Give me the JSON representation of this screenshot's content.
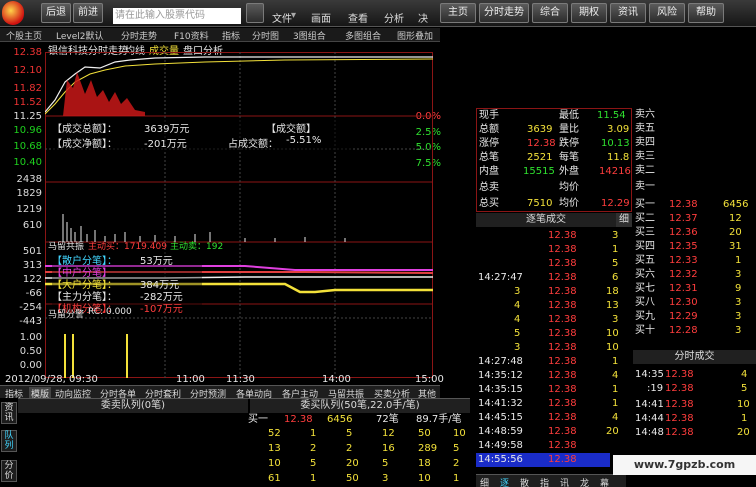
{
  "toolbar": {
    "buttons": [
      "后退",
      "前进",
      "主页",
      "分时走势",
      "综合",
      "期权",
      "资讯",
      "风险",
      "帮助"
    ],
    "back_label": "后退",
    "search_placeholder": "请在此输入股票代码",
    "menu": [
      "文件",
      "画面",
      "查看",
      "分析",
      "决"
    ]
  },
  "sectabs": {
    "items": [
      "个股主页",
      "Level2默认",
      "分时走势",
      "F10资料",
      "指标",
      "分时图",
      "3图组合",
      "多图组合",
      "图形叠加"
    ]
  },
  "chart_header": {
    "title": "银信科技分时走势",
    "legend": [
      "均线",
      "成交量",
      "盘口分析"
    ]
  },
  "price_axis": {
    "left": [
      "12.38",
      "12.10",
      "11.82",
      "11.52",
      "11.25",
      "10.96",
      "10.68",
      "10.40"
    ],
    "vol": [
      "2438",
      "1829",
      "1219",
      "610"
    ],
    "pct": [
      "0.0%",
      "2.5%",
      "5.0%",
      "7.5%"
    ],
    "lower": [
      "501",
      "313",
      "122",
      "-66",
      "-254",
      "-443"
    ]
  },
  "overlay1": {
    "total_turnover": "【成交总额】：",
    "total_value": "3639万元",
    "net_turnover": "【成交净额】：",
    "net_value": "-201万元",
    "ratio_label": "占成交额：",
    "ratio_value": "-5.51%",
    "turnover_tag": "【成交额】"
  },
  "mid_panel": {
    "title": "马留共振",
    "main_buy": "主动买：1719.409",
    "main_sell": "主动卖：192"
  },
  "overlay2": {
    "retail": "【散户分笔】：",
    "retail_val": "53万元",
    "mid": "【中户分笔】",
    "big": "【大户分笔】：",
    "big_val": "384万元",
    "main": "【主力分笔】：",
    "main_val": "-282万元",
    "inst": "【机构分笔】：",
    "inst_val": "-107万元"
  },
  "low_panel": {
    "title": "马留分警",
    "rc": "RC: 0.000",
    "yvals": [
      "1.00",
      "0.50",
      "0.00"
    ]
  },
  "time_axis": {
    "date": "2012/09/28, 09:30",
    "ticks": [
      "11:00",
      "11:30",
      "14:00",
      "15:00"
    ]
  },
  "bottom_tabs": [
    "指标",
    "模版",
    "动向监控",
    "分时各单",
    "分时套利",
    "分时预测",
    "各单动向",
    "各户主动",
    "马留共振",
    "买卖分析",
    "其他"
  ],
  "queue": {
    "left_title": "委卖队列(0笔)",
    "right_title": "委买队列(50笔,22.0手/笔)",
    "buy1": "买一",
    "price": "12.38",
    "vol": "6456",
    "count": "72笔",
    "avg": "89.7手/笔",
    "rows": [
      [
        "52",
        "1",
        "5",
        "12",
        "50",
        "10"
      ],
      [
        "13",
        "2",
        "2",
        "16",
        "289",
        "5"
      ],
      [
        "10",
        "5",
        "20",
        "5",
        "18",
        "2"
      ],
      [
        "61",
        "1",
        "50",
        "3",
        "10",
        "1"
      ]
    ]
  },
  "stats": {
    "rows": [
      [
        "现手",
        "",
        "最低",
        "11.54"
      ],
      [
        "总额",
        "3639",
        "量比",
        "3.09"
      ],
      [
        "涨停",
        "12.38",
        "跌停",
        "10.13"
      ],
      [
        "总笔",
        "2521",
        "每笔",
        "11.8"
      ],
      [
        "内盘",
        "15515",
        "外盘",
        "14216"
      ],
      [
        "总卖",
        "",
        "均价",
        ""
      ],
      [
        "总买",
        "7510",
        "均价",
        "12.29"
      ]
    ]
  },
  "sell_side": [
    "卖六",
    "卖五",
    "卖四",
    "卖三",
    "卖二",
    "卖一"
  ],
  "buy_side": [
    [
      "买一",
      "12.38",
      "6456"
    ],
    [
      "买二",
      "12.37",
      "12"
    ],
    [
      "买三",
      "12.36",
      "20"
    ],
    [
      "买四",
      "12.35",
      "31"
    ],
    [
      "买五",
      "12.33",
      "1"
    ],
    [
      "买六",
      "12.32",
      "3"
    ],
    [
      "买七",
      "12.31",
      "9"
    ],
    [
      "买八",
      "12.30",
      "3"
    ],
    [
      "买九",
      "12.29",
      "3"
    ],
    [
      "买十",
      "12.28",
      "3"
    ]
  ],
  "tick_panel": {
    "title": "逐笔成交",
    "tab": "细",
    "rows": [
      [
        "",
        "12.38",
        "3"
      ],
      [
        "",
        "12.38",
        "1"
      ],
      [
        "",
        "12.38",
        "5"
      ],
      [
        "14:27:47",
        "12.38",
        "6"
      ],
      [
        "3",
        "12.38",
        "18"
      ],
      [
        "4",
        "12.38",
        "13"
      ],
      [
        "4",
        "12.38",
        "3"
      ],
      [
        "5",
        "12.38",
        "10"
      ],
      [
        "3",
        "12.38",
        "10"
      ],
      [
        "14:27:48",
        "12.38",
        "1"
      ],
      [
        "14:35:12",
        "12.38",
        "4"
      ],
      [
        "14:35:15",
        "12.38",
        "1"
      ],
      [
        "14:41:32",
        "12.38",
        "1"
      ],
      [
        "14:45:15",
        "12.38",
        "4"
      ],
      [
        "14:48:59",
        "12.38",
        "20"
      ],
      [
        "14:49:58",
        "12.38",
        ""
      ],
      [
        "14:55:56",
        "12.38",
        ""
      ]
    ]
  },
  "minute_panel": {
    "title": "分时成交",
    "rows": [
      [
        "14:35",
        "12.38",
        "4"
      ],
      [
        ":19",
        "12.38",
        "5"
      ],
      [
        "14:41",
        "12.38",
        "10"
      ],
      [
        "14:44",
        "12.38",
        "1"
      ],
      [
        "14:48",
        "12.38",
        "20"
      ]
    ]
  },
  "bottom_right_tabs": [
    "细",
    "逐",
    "散",
    "指",
    "讯",
    "龙",
    "幕"
  ],
  "side_tabs": [
    "资讯",
    "队列",
    "分价"
  ],
  "watermark": "www.7gpzb.com"
}
